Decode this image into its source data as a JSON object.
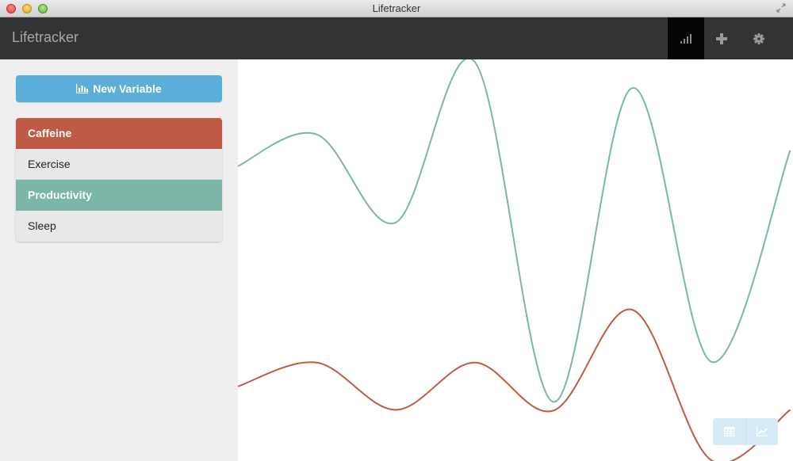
{
  "window": {
    "title": "Lifetracker"
  },
  "header": {
    "brand": "Lifetracker",
    "buttons": [
      {
        "icon": "signal-bars-icon",
        "active": true
      },
      {
        "icon": "plus-icon",
        "active": false
      },
      {
        "icon": "gear-icon",
        "active": false
      }
    ]
  },
  "sidebar": {
    "new_variable_label": "New Variable",
    "new_variable_icon": "bar-chart-icon",
    "variables": [
      {
        "label": "Caffeine",
        "color": "#bf5b44",
        "selected": true
      },
      {
        "label": "Exercise",
        "color": "#e8e8e8",
        "selected": false
      },
      {
        "label": "Productivity",
        "color": "#7bb6a8",
        "selected": true
      },
      {
        "label": "Sleep",
        "color": "#e8e8e8",
        "selected": false
      }
    ]
  },
  "chart_data": {
    "type": "line",
    "x": [
      0,
      1,
      2,
      3,
      4,
      5,
      6,
      7
    ],
    "ylim": [
      0,
      100
    ],
    "grid": false,
    "legend": "none",
    "series": [
      {
        "color": "#7bb6a8",
        "values": [
          73.7,
          81.7,
          59.5,
          100,
          14.3,
          93.4,
          24.4,
          77.7
        ]
      },
      {
        "color": "#bf5b44",
        "values": [
          18.2,
          24.2,
          12.3,
          24.2,
          12.1,
          37.5,
          -0.4,
          12.3
        ]
      }
    ]
  },
  "view_toggle": {
    "buttons": [
      "calendar-icon",
      "line-chart-icon"
    ]
  }
}
